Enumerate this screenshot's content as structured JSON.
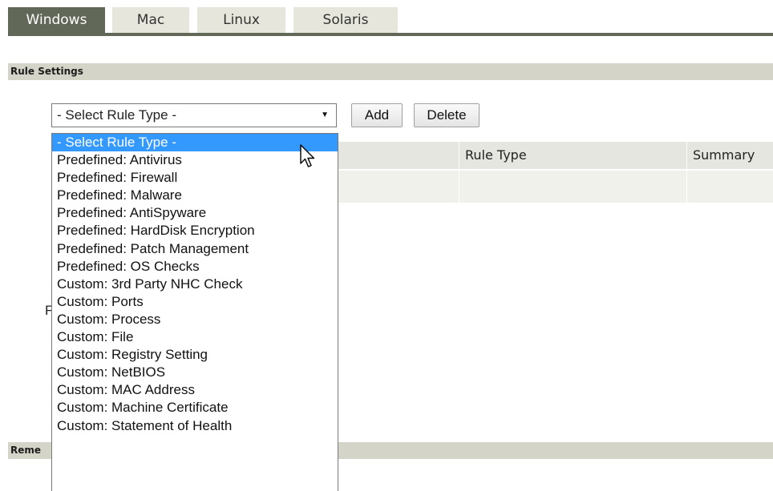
{
  "tabs": [
    "Windows",
    "Mac",
    "Linux",
    "Solaris"
  ],
  "active_tab": "Windows",
  "sections": {
    "rule_settings": "Rule Settings",
    "remediation_partial": "Reme"
  },
  "rule_type_select": {
    "value": "- Select Rule Type -",
    "arrow": "▼"
  },
  "buttons": {
    "add": "Add",
    "delete": "Delete"
  },
  "table": {
    "columns": [
      "Rule Type",
      "Summary"
    ]
  },
  "stray_text": "F",
  "dropdown_options": [
    "- Select Rule Type -",
    "Predefined: Antivirus",
    "Predefined: Firewall",
    "Predefined: Malware",
    "Predefined: AntiSpyware",
    "Predefined: HardDisk Encryption",
    "Predefined: Patch Management",
    "Predefined: OS Checks",
    "Custom: 3rd Party NHC Check",
    "Custom: Ports",
    "Custom: Process",
    "Custom: File",
    "Custom: Registry Setting",
    "Custom: NetBIOS",
    "Custom: MAC Address",
    "Custom: Machine Certificate",
    "Custom: Statement of Health"
  ],
  "selected_option": "- Select Rule Type -",
  "colors": {
    "active_tab": "#626858",
    "inactive_tab": "#e6e6dc",
    "section_header": "#d4d4c8",
    "selection": "#3399ff"
  },
  "icons": {
    "cursor": "mouse-pointer-icon",
    "dropdown_arrow": "chevron-down-icon"
  }
}
